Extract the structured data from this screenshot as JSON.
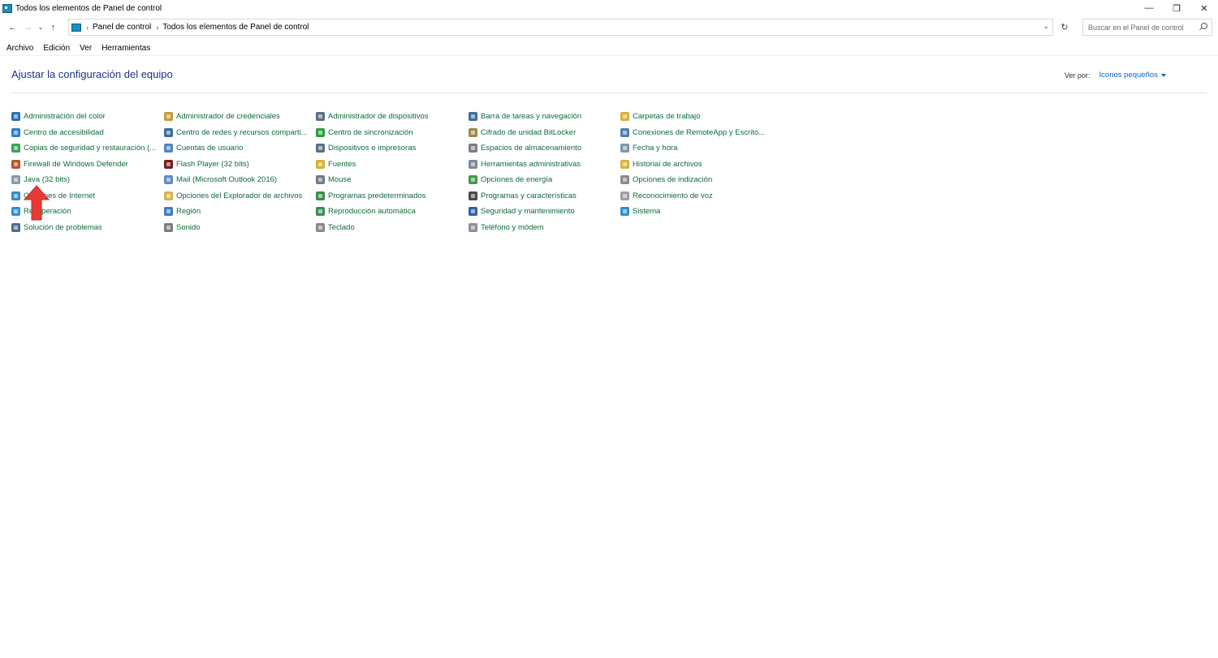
{
  "window": {
    "title": "Todos los elementos de Panel de control",
    "controls": {
      "minimize": "—",
      "restore": "❐",
      "close": "✕"
    }
  },
  "nav": {
    "back": "←",
    "forward": "→",
    "recent": "⌄",
    "up": "↑",
    "breadcrumbs": [
      "Panel de control",
      "Todos los elementos de Panel de control"
    ],
    "refresh": "↻",
    "dropdown": "⌄",
    "search_placeholder": "Buscar en el Panel de control"
  },
  "menu": [
    "Archivo",
    "Edición",
    "Ver",
    "Herramientas"
  ],
  "main": {
    "title": "Ajustar la configuración del equipo",
    "view_by_label": "Ver por:",
    "view_by_value": "Iconos pequeños"
  },
  "colors": {
    "link": "#0c6b3a",
    "title": "#1e3287",
    "accent": "#0066cc",
    "arrow": "#e83a35"
  },
  "columns": [
    [
      {
        "label": "Administración del color",
        "icon": "color-management-icon",
        "color": "#2d6fb7"
      },
      {
        "label": "Centro de accesibilidad",
        "icon": "accessibility-icon",
        "color": "#2a7fd1"
      },
      {
        "label": "Copias de seguridad y restauración (...",
        "icon": "backup-icon",
        "color": "#3aa35b"
      },
      {
        "label": "Firewall de Windows Defender",
        "icon": "firewall-icon",
        "color": "#b5562c"
      },
      {
        "label": "Java (32 bits)",
        "icon": "java-icon",
        "color": "#8a9aa8"
      },
      {
        "label": "Opciones de Internet",
        "icon": "internet-options-icon",
        "color": "#3b88c4"
      },
      {
        "label": "Recuperación",
        "icon": "recovery-icon",
        "color": "#2f8fd8"
      },
      {
        "label": "Solución de problemas",
        "icon": "troubleshooting-icon",
        "color": "#4f6d8a"
      }
    ],
    [
      {
        "label": "Administrador de credenciales",
        "icon": "credentials-icon",
        "color": "#c89a3c"
      },
      {
        "label": "Centro de redes y recursos comparti...",
        "icon": "network-center-icon",
        "color": "#3c6e9b"
      },
      {
        "label": "Cuentas de usuario",
        "icon": "user-accounts-icon",
        "color": "#4f86c1"
      },
      {
        "label": "Flash Player (32 bits)",
        "icon": "flash-icon",
        "color": "#7a1c1c"
      },
      {
        "label": "Mail (Microsoft Outlook 2016)",
        "icon": "mail-icon",
        "color": "#5b8fbf"
      },
      {
        "label": "Opciones del Explorador de archivos",
        "icon": "folder-options-icon",
        "color": "#d8b24a"
      },
      {
        "label": "Región",
        "icon": "region-icon",
        "color": "#3b7fbf"
      },
      {
        "label": "Sonido",
        "icon": "sound-icon",
        "color": "#7d7d7d"
      }
    ],
    [
      {
        "label": "Administrador de dispositivos",
        "icon": "device-manager-icon",
        "color": "#5c6f82"
      },
      {
        "label": "Centro de sincronización",
        "icon": "sync-center-icon",
        "color": "#2e9e3e"
      },
      {
        "label": "Dispositivos e impresoras",
        "icon": "printers-icon",
        "color": "#5a6f80"
      },
      {
        "label": "Fuentes",
        "icon": "fonts-icon",
        "color": "#d9b230"
      },
      {
        "label": "Mouse",
        "icon": "mouse-icon",
        "color": "#6f7a85"
      },
      {
        "label": "Programas predeterminados",
        "icon": "default-programs-icon",
        "color": "#3c8f4e"
      },
      {
        "label": "Reproducción automática",
        "icon": "autoplay-icon",
        "color": "#3b8c5a"
      },
      {
        "label": "Teclado",
        "icon": "keyboard-icon",
        "color": "#8a8a8a"
      }
    ],
    [
      {
        "label": "Barra de tareas y navegación",
        "icon": "taskbar-icon",
        "color": "#3c6fa3"
      },
      {
        "label": "Cifrado de unidad BitLocker",
        "icon": "bitlocker-icon",
        "color": "#a08a4a"
      },
      {
        "label": "Espacios de almacenamiento",
        "icon": "storage-spaces-icon",
        "color": "#7a7f86"
      },
      {
        "label": "Herramientas administrativas",
        "icon": "admin-tools-icon",
        "color": "#7d8a95"
      },
      {
        "label": "Opciones de energía",
        "icon": "power-options-icon",
        "color": "#3f9a48"
      },
      {
        "label": "Programas y características",
        "icon": "programs-features-icon",
        "color": "#4a4a4a"
      },
      {
        "label": "Seguridad y mantenimiento",
        "icon": "security-flag-icon",
        "color": "#2f63a8"
      },
      {
        "label": "Teléfono y módem",
        "icon": "phone-modem-icon",
        "color": "#8a8f96"
      }
    ],
    [
      {
        "label": "Carpetas de trabajo",
        "icon": "work-folders-icon",
        "color": "#d8b23c"
      },
      {
        "label": "Conexiones de RemoteApp y Escrito...",
        "icon": "remoteapp-icon",
        "color": "#4f7fae"
      },
      {
        "label": "Fecha y hora",
        "icon": "date-time-icon",
        "color": "#7f95a8"
      },
      {
        "label": "Historial de archivos",
        "icon": "file-history-icon",
        "color": "#d6b33e"
      },
      {
        "label": "Opciones de indización",
        "icon": "indexing-icon",
        "color": "#8a8a8a"
      },
      {
        "label": "Reconocimiento de voz",
        "icon": "speech-icon",
        "color": "#9aa0a6"
      },
      {
        "label": "Sistema",
        "icon": "system-icon",
        "color": "#2f8fcf"
      }
    ]
  ]
}
